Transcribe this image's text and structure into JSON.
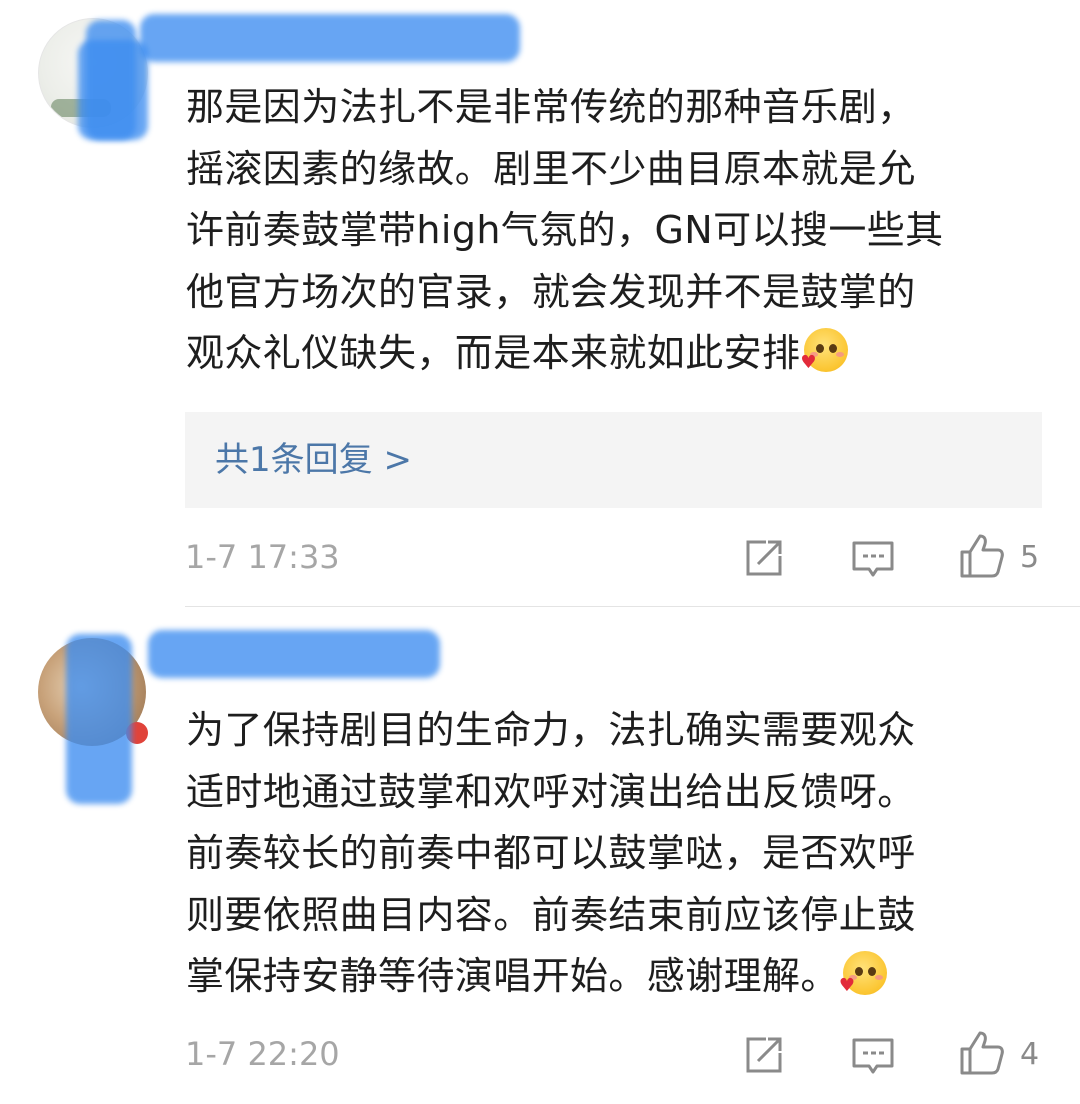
{
  "comments": [
    {
      "lines": [
        "那是因为法扎不是非常传统的那种音乐剧，",
        "摇滚因素的缘故。剧里不少曲目原本就是允",
        "许前奏鼓掌带high气氛的，GN可以搜一些其",
        "他官方场次的官录，就会发现并不是鼓掌的",
        "观众礼仪缺失，而是本来就如此安排"
      ],
      "reply_link": "共1条回复 >",
      "time": "1-7 17:33",
      "likes": "5",
      "emoji_icon": "blush-heart-emoji"
    },
    {
      "lines": [
        "为了保持剧目的生命力，法扎确实需要观众",
        "适时地通过鼓掌和欢呼对演出给出反馈呀。",
        "前奏较长的前奏中都可以鼓掌哒，是否欢呼",
        "则要依照曲目内容。前奏结束前应该停止鼓",
        "掌保持安静等待演唱开始。感谢理解。"
      ],
      "time": "1-7 22:20",
      "likes": "4",
      "emoji_icon": "blush-heart-emoji"
    }
  ],
  "icons": {
    "share": "share-icon",
    "comment": "comment-icon",
    "like": "thumbs-up-icon"
  },
  "colors": {
    "link": "#4c77a8",
    "meta": "#a6a6a6",
    "redaction": "#3d8df0"
  }
}
